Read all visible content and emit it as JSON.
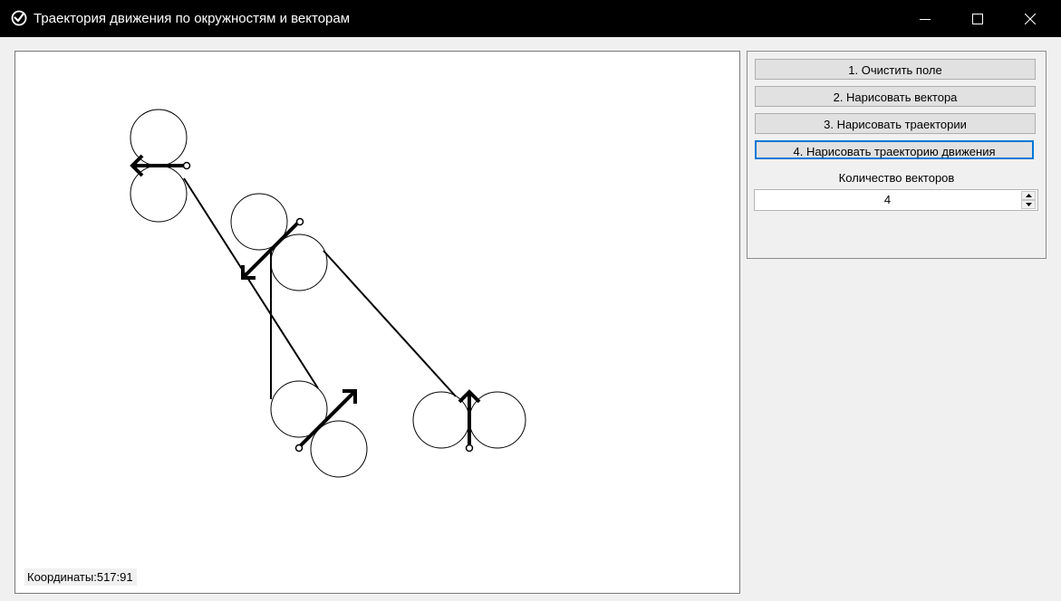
{
  "window": {
    "title": "Траектория движения по окружностям и векторам",
    "icons": {
      "app": "app-logo-icon",
      "minimize": "minimize-icon",
      "maximize": "maximize-icon",
      "close": "close-icon"
    }
  },
  "canvas": {
    "coordinates_label": "Координаты:517:91",
    "stroke_color": "#000000",
    "background_color": "#ffffff"
  },
  "controls": {
    "buttons": [
      {
        "label": "1. Очистить поле"
      },
      {
        "label": "2. Нарисовать вектора"
      },
      {
        "label": "3. Нарисовать траектории"
      },
      {
        "label": "4. Нарисовать траекторию движения",
        "focused": true
      }
    ],
    "vector_count_label": "Количество векторов",
    "vector_count_value": "4",
    "focus_color": "#0078d7"
  },
  "colors": {
    "titlebar": "#000000",
    "window_bg": "#f0f0f0",
    "button_bg": "#e1e1e1"
  }
}
